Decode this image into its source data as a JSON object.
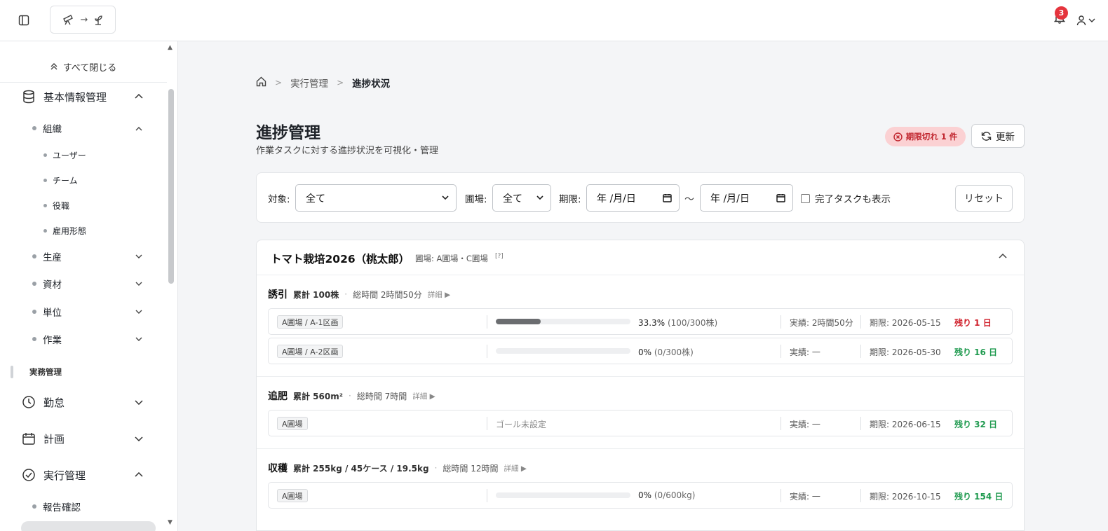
{
  "topbar": {
    "logo_arrow": "→",
    "notification_count": "3"
  },
  "sidebar": {
    "collapse_all": "すべて閉じる",
    "groups": {
      "basic": "基本情報管理",
      "org": "組織",
      "org_items": [
        "ユーザー",
        "チーム",
        "役職",
        "雇用形態"
      ],
      "production": "生産",
      "materials": "資材",
      "units": "単位",
      "work": "作業"
    },
    "section_label": "実務管理",
    "attendance": "勤怠",
    "plan": "計画",
    "execution": "実行管理",
    "report": "報告確認"
  },
  "breadcrumb": {
    "items": [
      "実行管理",
      "進捗状況"
    ]
  },
  "page": {
    "title": "進捗管理",
    "subtitle": "作業タスクに対する進捗状況を可視化・管理",
    "overdue_badge": "期限切れ 1 件",
    "refresh_label": "更新"
  },
  "filters": {
    "target_label": "対象:",
    "target_value": "全て",
    "field_label": "圃場:",
    "field_value": "全て",
    "deadline_label": "期限:",
    "date_from_placeholder": "年 /月/日",
    "date_to_placeholder": "年 /月/日",
    "range_sep": "〜",
    "show_completed_label": "完了タスクも表示",
    "reset_label": "リセット"
  },
  "project": {
    "title": "トマト栽培2026（桃太郎）",
    "fields": "圃場: A圃場・C圃場",
    "help": "[?]",
    "tasks": [
      {
        "name": "誘引",
        "total": "累計 100株",
        "time": "総時間 2時間50分",
        "detail": "詳細 ▶",
        "rows": [
          {
            "tag": "A圃場 / A-1区画",
            "progress": 0.333,
            "pct": "33.3%",
            "frac": "(100/300株)",
            "actual": "実績: 2時間50分",
            "deadline": "期限: 2026-05-15",
            "remain": "残り 1 日",
            "status": "red"
          },
          {
            "tag": "A圃場 / A-2区画",
            "progress": 0,
            "pct": "0%",
            "frac": "(0/300株)",
            "actual": "実績: 一",
            "deadline": "期限: 2026-05-30",
            "remain": "残り 16 日",
            "status": "green"
          }
        ]
      },
      {
        "name": "追肥",
        "total": "累計 560m²",
        "time": "総時間 7時間",
        "detail": "詳細 ▶",
        "rows": [
          {
            "tag": "A圃場",
            "nogoal": "ゴール未設定",
            "actual": "実績: 一",
            "deadline": "期限: 2026-06-15",
            "remain": "残り 32 日",
            "status": "green"
          }
        ]
      },
      {
        "name": "収穫",
        "total": "累計 255kg / 45ケース / 19.5kg",
        "time": "総時間 12時間",
        "detail": "詳細 ▶",
        "rows": [
          {
            "tag": "A圃場",
            "progress": 0,
            "pct": "0%",
            "frac": "(0/600kg)",
            "actual": "実績: 一",
            "deadline": "期限: 2026-10-15",
            "remain": "残り 154 日",
            "status": "green"
          }
        ]
      }
    ]
  },
  "colors": {
    "danger": "#d0212c",
    "success": "#1f9a4f",
    "badge": "#e5343d"
  }
}
